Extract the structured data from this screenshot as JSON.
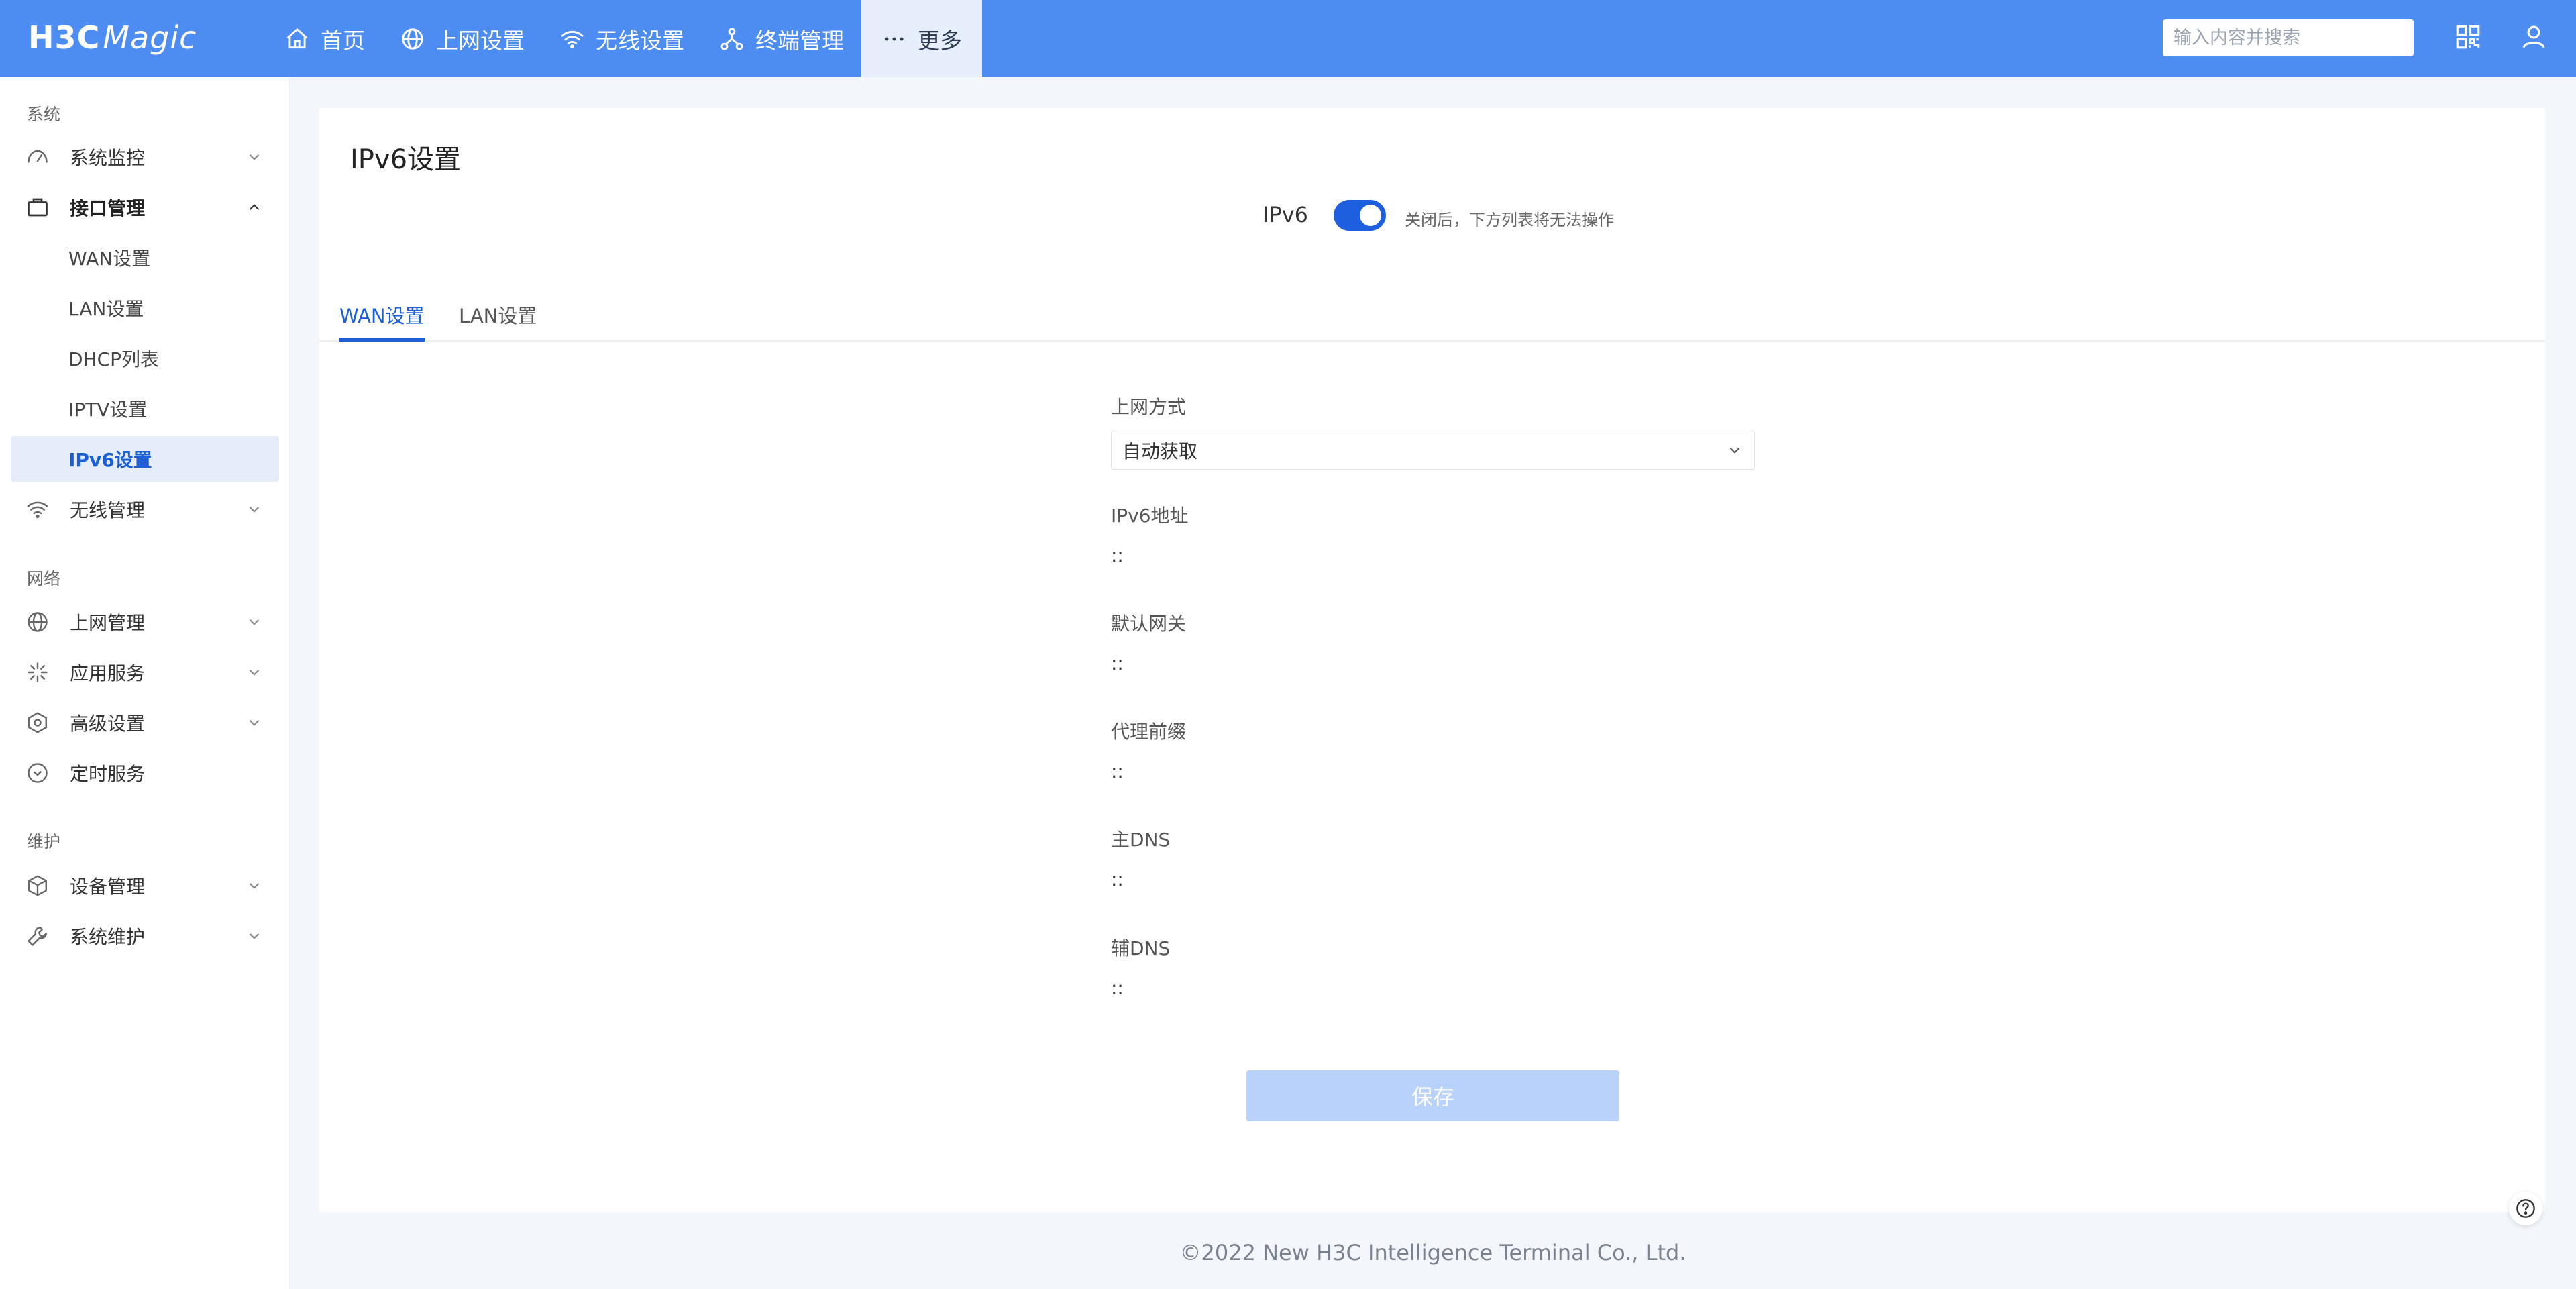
{
  "header": {
    "logo_main": "H3C",
    "logo_sub": "Magic",
    "nav": [
      {
        "label": "首页",
        "icon": "home-icon"
      },
      {
        "label": "上网设置",
        "icon": "globe-icon"
      },
      {
        "label": "无线设置",
        "icon": "wifi-icon"
      },
      {
        "label": "终端管理",
        "icon": "network-icon"
      },
      {
        "label": "更多",
        "icon": "more-icon"
      }
    ],
    "search_placeholder": "输入内容并搜索"
  },
  "sidebar": {
    "groups": [
      "系统",
      "网络",
      "维护"
    ],
    "items": [
      {
        "label": "系统监控",
        "icon": "gauge-icon"
      },
      {
        "label": "接口管理",
        "icon": "briefcase-icon"
      },
      {
        "label": "无线管理",
        "icon": "wifi-icon"
      },
      {
        "label": "上网管理",
        "icon": "globe-icon"
      },
      {
        "label": "应用服务",
        "icon": "sparkle-icon"
      },
      {
        "label": "高级设置",
        "icon": "hexagon-icon"
      },
      {
        "label": "定时服务",
        "icon": "clock-icon"
      },
      {
        "label": "设备管理",
        "icon": "cube-icon"
      },
      {
        "label": "系统维护",
        "icon": "wrench-icon"
      }
    ],
    "sub_items": [
      "WAN设置",
      "LAN设置",
      "DHCP列表",
      "IPTV设置",
      "IPv6设置"
    ]
  },
  "main": {
    "title": "IPv6设置",
    "ipv6_label": "IPv6",
    "ipv6_enabled": true,
    "ipv6_hint": "关闭后，下方列表将无法操作",
    "tabs": [
      "WAN设置",
      "LAN设置"
    ],
    "fields": {
      "mode_label": "上网方式",
      "mode_value": "自动获取",
      "address_label": "IPv6地址",
      "address_value": "::",
      "gateway_label": "默认网关",
      "gateway_value": "::",
      "prefix_label": "代理前缀",
      "prefix_value": "::",
      "dns1_label": "主DNS",
      "dns1_value": "::",
      "dns2_label": "辅DNS",
      "dns2_value": "::"
    },
    "save_label": "保存"
  },
  "footer": {
    "copyright": "©2022 New H3C Intelligence Terminal Co., Ltd."
  },
  "colors": {
    "topbar": "#4d8cf0",
    "accent": "#1a5fd6",
    "save_disabled": "#b9d2fb"
  }
}
